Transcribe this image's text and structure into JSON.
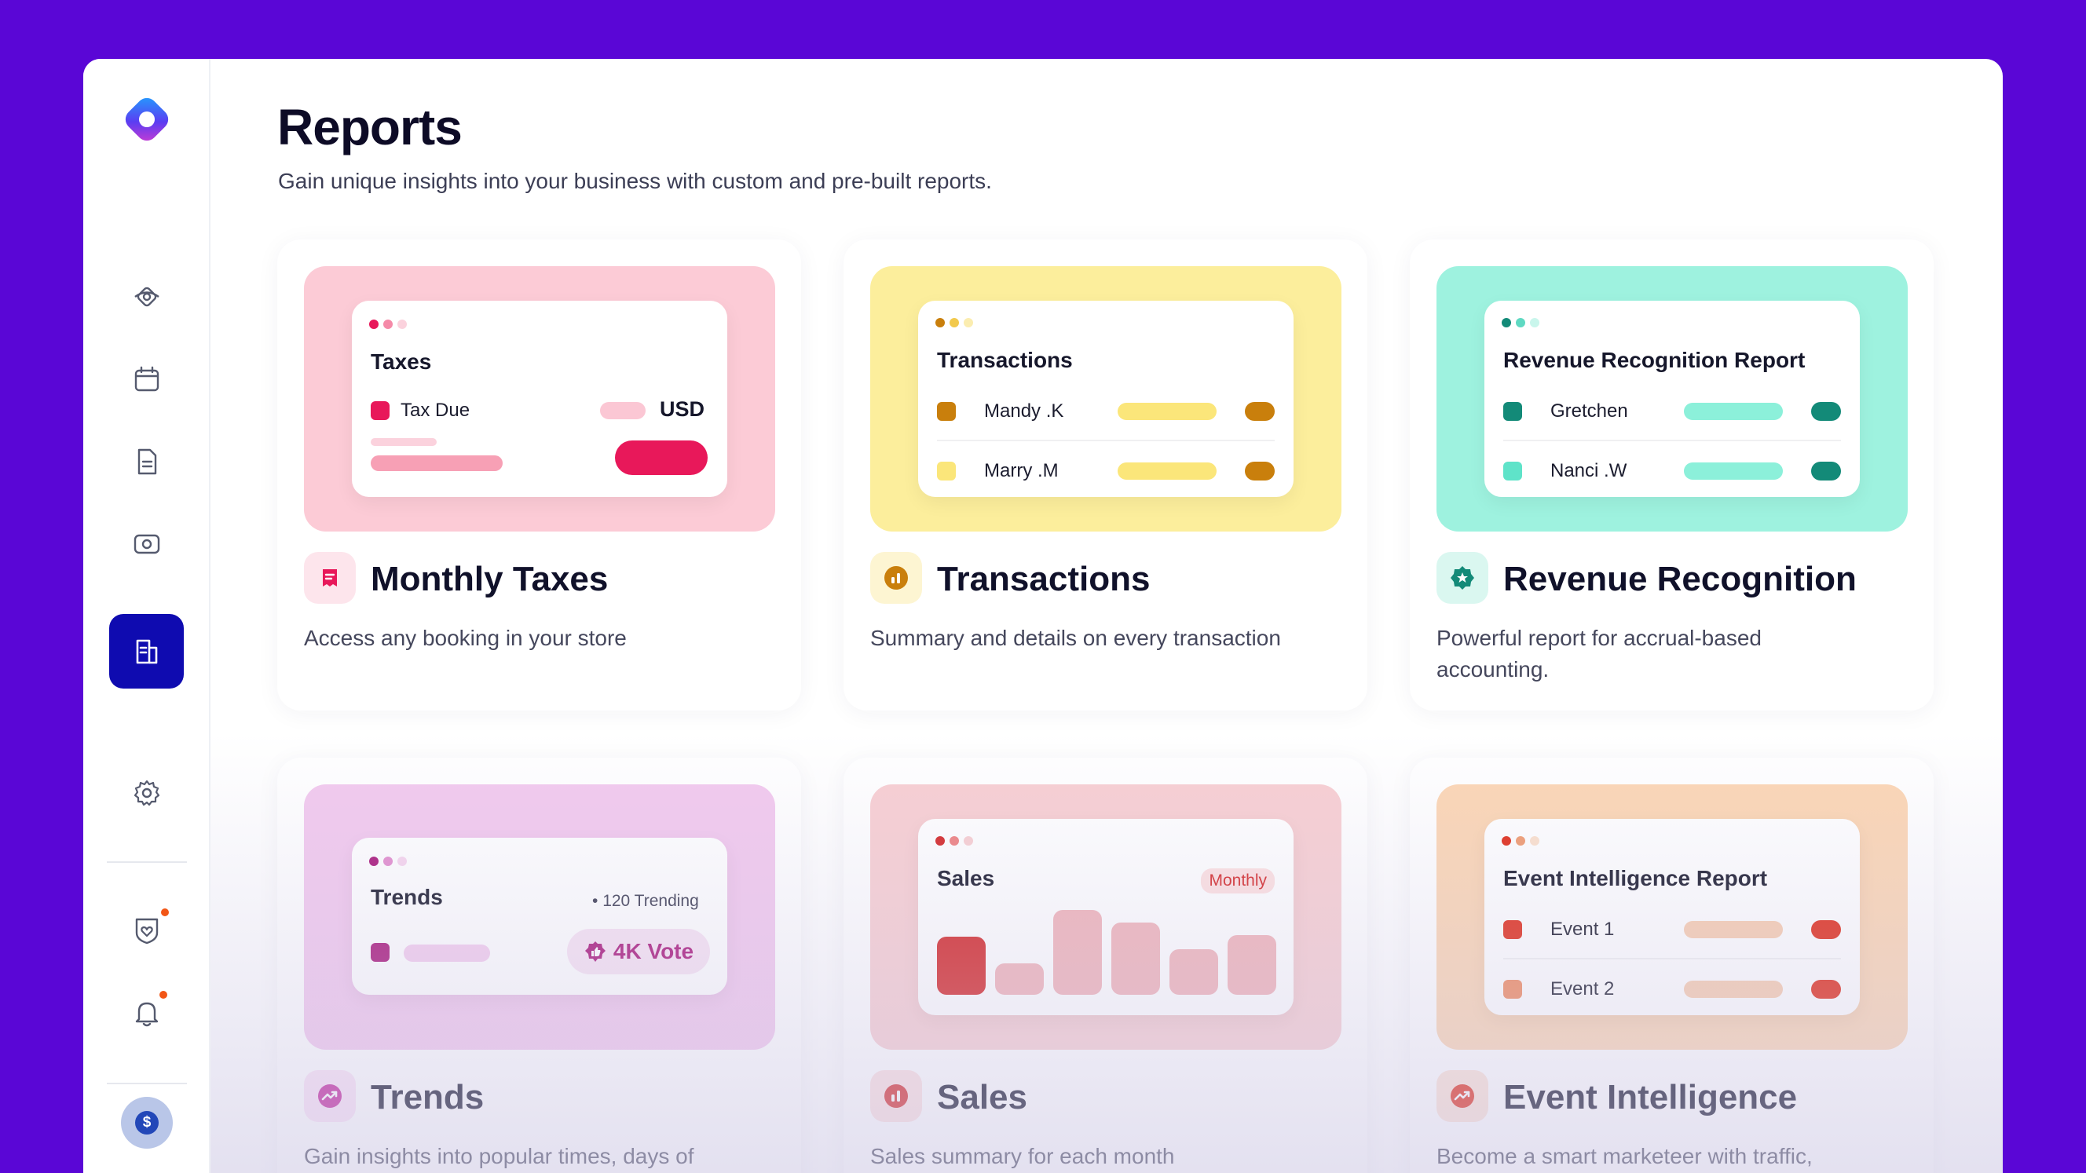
{
  "header": {
    "title": "Reports",
    "subtitle": "Gain unique insights into your business with custom and pre-built reports."
  },
  "sidebar": {
    "items": [
      {
        "icon": "orbit-icon",
        "active": false
      },
      {
        "icon": "calendar-icon",
        "active": false
      },
      {
        "icon": "document-icon",
        "active": false
      },
      {
        "icon": "payment-card-icon",
        "active": false
      },
      {
        "icon": "box-icon",
        "active": false
      },
      {
        "icon": "reports-icon",
        "active": true
      },
      {
        "icon": "gear-icon",
        "active": false
      },
      {
        "icon": "heart-shield-icon",
        "active": false,
        "badge": true
      },
      {
        "icon": "bell-icon",
        "active": false,
        "badge": true
      }
    ],
    "avatar": {
      "glyph": "$"
    }
  },
  "cards": {
    "monthly_taxes": {
      "title": "Monthly Taxes",
      "description": "Access any booking in your store",
      "preview": {
        "title": "Taxes",
        "row_label": "Tax Due",
        "currency": "USD"
      },
      "colors": {
        "bg": "#fccbd6",
        "accent": "#e8185a"
      }
    },
    "transactions": {
      "title": "Transactions",
      "description": "Summary and details on every transaction",
      "preview": {
        "title": "Transactions",
        "rows": [
          "Mandy .K",
          "Marry .M"
        ]
      },
      "colors": {
        "bg": "#fcee9c",
        "accent": "#c97f0c"
      }
    },
    "revenue_recognition": {
      "title": "Revenue Recognition",
      "description": "Powerful report for accrual-based accounting.",
      "preview": {
        "title": "Revenue Recognition Report",
        "rows": [
          "Gretchen",
          "Nanci .W"
        ]
      },
      "colors": {
        "bg": "#9ef2df",
        "accent": "#138a78"
      }
    },
    "trends": {
      "title": "Trends",
      "description": "Gain insights into popular times, days of",
      "preview": {
        "title": "Trends",
        "trending": "120 Trending",
        "vote": "4K Vote"
      },
      "colors": {
        "bg": "#f2c9ee",
        "accent": "#a8167a"
      }
    },
    "sales": {
      "title": "Sales",
      "description": "Sales summary for each month",
      "preview": {
        "title": "Sales",
        "badge": "Monthly"
      },
      "colors": {
        "bg": "#f8cfd2",
        "accent": "#d42626"
      }
    },
    "event_intelligence": {
      "title": "Event Intelligence",
      "description": "Become a smart marketeer with traffic,",
      "preview": {
        "title": "Event Intelligence Report",
        "rows": [
          "Event 1",
          "Event 2"
        ]
      },
      "colors": {
        "bg": "#fcd6b4",
        "accent": "#e02a16"
      }
    }
  }
}
